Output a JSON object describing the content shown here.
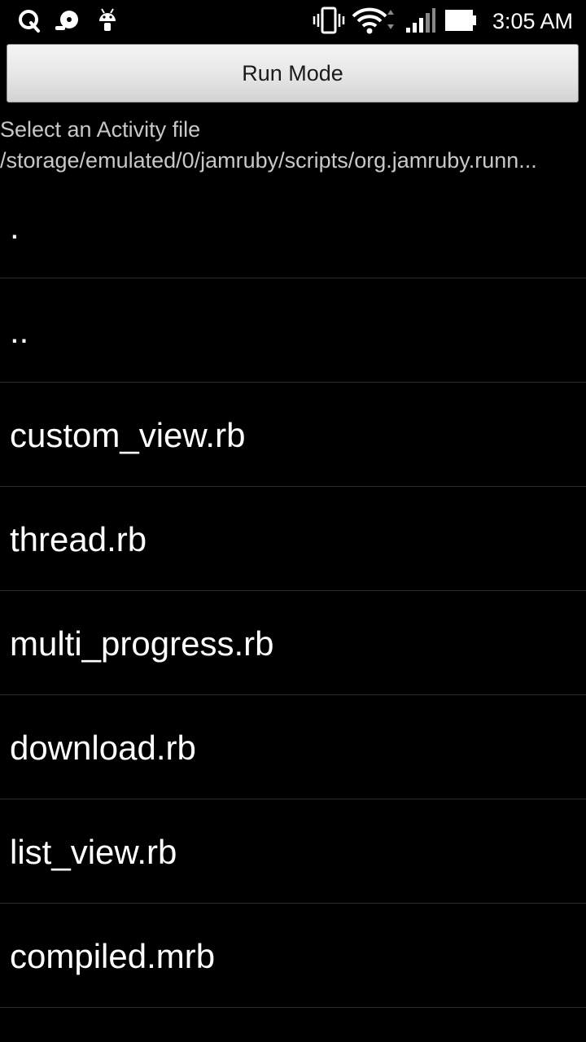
{
  "status_bar": {
    "time": "3:05 AM",
    "left_icons": [
      "q-app-icon",
      "media-player-icon",
      "android-debug-icon"
    ],
    "right_icons": [
      "vibrate-icon",
      "wifi-icon",
      "cell-signal-icon",
      "battery-icon"
    ]
  },
  "toolbar": {
    "run_mode_label": "Run Mode"
  },
  "header": {
    "prompt": "Select an Activity file",
    "path": "/storage/emulated/0/jamruby/scripts/org.jamruby.runn..."
  },
  "files": [
    ".",
    "..",
    "custom_view.rb",
    "thread.rb",
    "multi_progress.rb",
    "download.rb",
    "list_view.rb",
    "compiled.mrb"
  ]
}
